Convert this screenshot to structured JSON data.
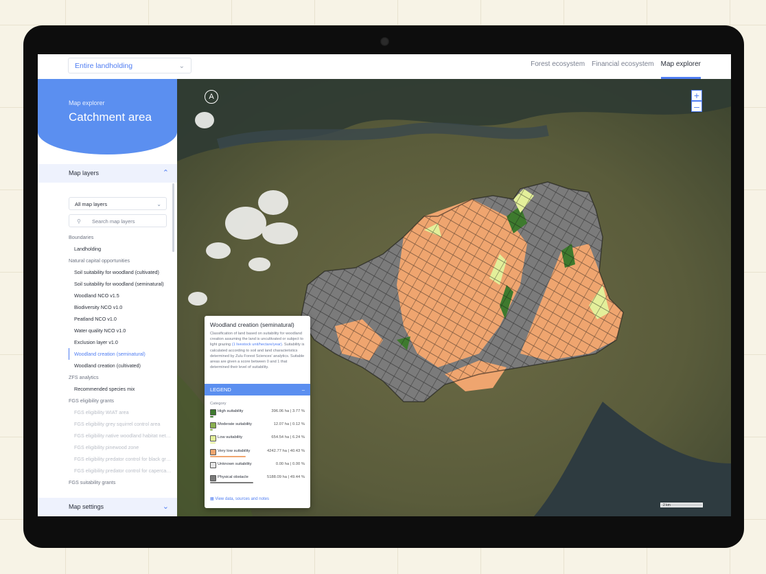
{
  "header": {
    "area_select": "Entire landholding",
    "tabs": [
      {
        "label": "Forest ecosystem",
        "active": false
      },
      {
        "label": "Financial ecosystem",
        "active": false
      },
      {
        "label": "Map explorer",
        "active": true
      }
    ]
  },
  "sidebar": {
    "subtitle": "Map explorer",
    "title": "Catchment area",
    "map_layers_label": "Map layers",
    "layers_filter": "All map layers",
    "search_placeholder": "Search map layers",
    "map_settings_label": "Map settings",
    "groups": [
      {
        "name": "Boundaries",
        "items": [
          {
            "label": "Landholding"
          }
        ]
      },
      {
        "name": "Natural capital opportunities",
        "items": [
          {
            "label": "Soil suitability for woodland (cultivated)"
          },
          {
            "label": "Soil suitability for woodland (seminatural)"
          },
          {
            "label": "Woodland NCO v1.5"
          },
          {
            "label": "Biodiversity NCO v1.0"
          },
          {
            "label": "Peatland NCO v1.0"
          },
          {
            "label": "Water quality NCO v1.0"
          },
          {
            "label": "Exclusion layer v1.0"
          },
          {
            "label": "Woodland creation (seminatural)",
            "active": true
          },
          {
            "label": "Woodland creation (cultivated)"
          }
        ]
      },
      {
        "name": "ZFS analytics",
        "items": [
          {
            "label": "Recommended species mix"
          }
        ]
      },
      {
        "name": "FGS eligibility grants",
        "items": [
          {
            "label": "FGS eligibility WIAT area",
            "disabled": true
          },
          {
            "label": "FGS eligibility grey squirrel control area",
            "disabled": true
          },
          {
            "label": "FGS eligibility native woodland habitat network",
            "disabled": true
          },
          {
            "label": "FGS eligibility pinewood zone",
            "disabled": true
          },
          {
            "label": "FGS eligibility predator control for black grouse",
            "disabled": true
          },
          {
            "label": "FGS eligibility predator control for capercaillie",
            "disabled": true
          }
        ]
      },
      {
        "name": "FGS suitability grants",
        "items": []
      }
    ]
  },
  "map": {
    "zoom_in": "+",
    "zoom_out": "–",
    "scale_label": "2 km",
    "north_symbol": "A"
  },
  "info_card": {
    "title": "Woodland creation (seminatural)",
    "desc_before": "Classification of land based on suitability for woodland creation assuming the land is uncultivated or subject to light grazing ",
    "desc_highlight": "(1 livestock unit/hectare/year)",
    "desc_after": ". Suitability is calculated according to soil and land characteristics determined by Zulu Forest Sciences' analytics. Suitable areas are given a score between 0 and 1 that determined their level of suitability.",
    "legend_label": "LEGEND",
    "legend_toggle": "–",
    "category_label": "Category",
    "rows": [
      {
        "label": "High suitability",
        "value": "396.06 ha | 3.77 %",
        "color": "#3e7a2e",
        "pct": 3.77
      },
      {
        "label": "Moderate suitability",
        "value": "12.07 ha | 0.12 %",
        "color": "#8ab04f",
        "pct": 0.12
      },
      {
        "label": "Low suitability",
        "value": "654.54 ha | 6.24 %",
        "color": "#e3ef9a",
        "pct": 6.24
      },
      {
        "label": "Very low suitability",
        "value": "4242.77 ha | 40.43 %",
        "color": "#f0a66f",
        "pct": 40.43
      },
      {
        "label": "Unknown suitability",
        "value": "0.00 ha | 0.00 %",
        "color": "#e6e6e6",
        "pct": 0.0
      },
      {
        "label": "Physical obstacle",
        "value": "5188.09 ha | 49.44 %",
        "color": "#7a7a7a",
        "pct": 49.44
      }
    ],
    "link": "View data, sources and notes"
  }
}
